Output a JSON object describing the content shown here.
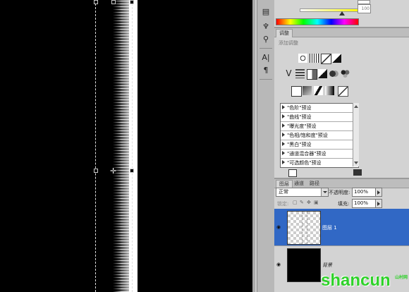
{
  "panels": {
    "color": {
      "value_field": "100"
    },
    "adjustments": {
      "tab_label": "调整",
      "subtitle": "添加调整",
      "presets": [
        "\"色阶\"预设",
        "\"曲线\"预设",
        "\"曝光度\"预设",
        "\"色相/饱和度\"预设",
        "\"黑白\"预设",
        "\"通道混合器\"预设",
        "\"可选颜色\"预设"
      ]
    },
    "layers": {
      "tabs": [
        "图层",
        "通道",
        "路径"
      ],
      "blend_mode": "正常",
      "opacity_label": "不透明度:",
      "opacity_value": "100%",
      "lock_label": "锁定:",
      "fill_label": "填充:",
      "fill_value": "100%",
      "items": [
        {
          "name": "图层 1",
          "selected": true
        },
        {
          "name": "背景",
          "selected": false
        }
      ]
    }
  },
  "watermark": {
    "text": "shancun",
    "small": "山村网"
  },
  "colors": {
    "selection": "#3168c5",
    "watermark": "#2fd12a"
  }
}
